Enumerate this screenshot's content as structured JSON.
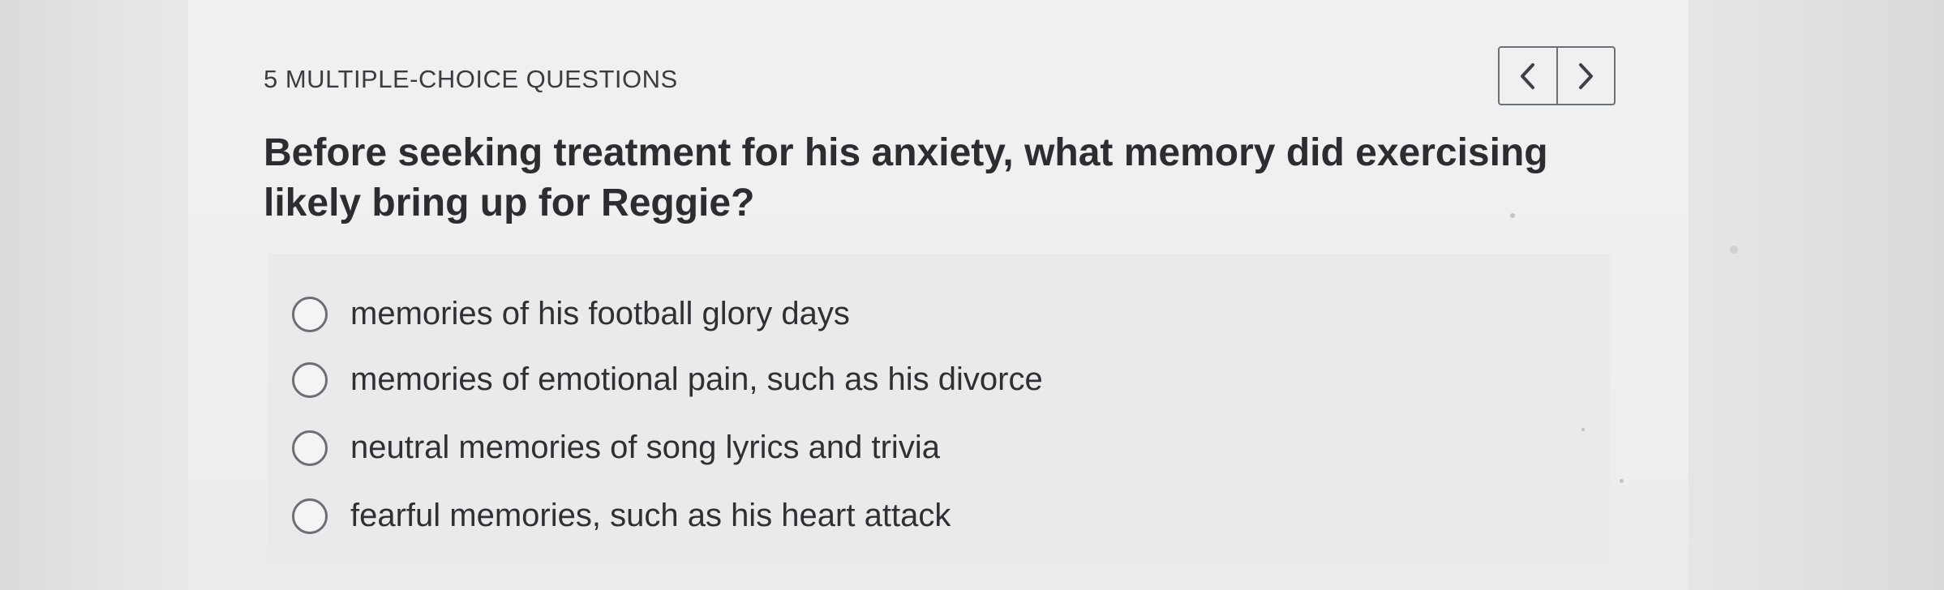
{
  "quiz": {
    "section_label": "5 MULTIPLE-CHOICE QUESTIONS",
    "nav": {
      "prev_icon": "chevron-left-icon",
      "next_icon": "chevron-right-icon"
    },
    "question": "Before seeking treatment for his anxiety, what memory did exercising likely bring up for Reggie?",
    "options": [
      {
        "label": "memories of his football glory days",
        "selected": false
      },
      {
        "label": "memories of emotional pain, such as his divorce",
        "selected": false
      },
      {
        "label": "neutral memories of song lyrics and trivia",
        "selected": false
      },
      {
        "label": "fearful memories, such as his heart attack",
        "selected": false
      }
    ]
  },
  "colors": {
    "text_primary": "#2b2d31",
    "border": "#6d7075",
    "background": "#eeeff1"
  }
}
